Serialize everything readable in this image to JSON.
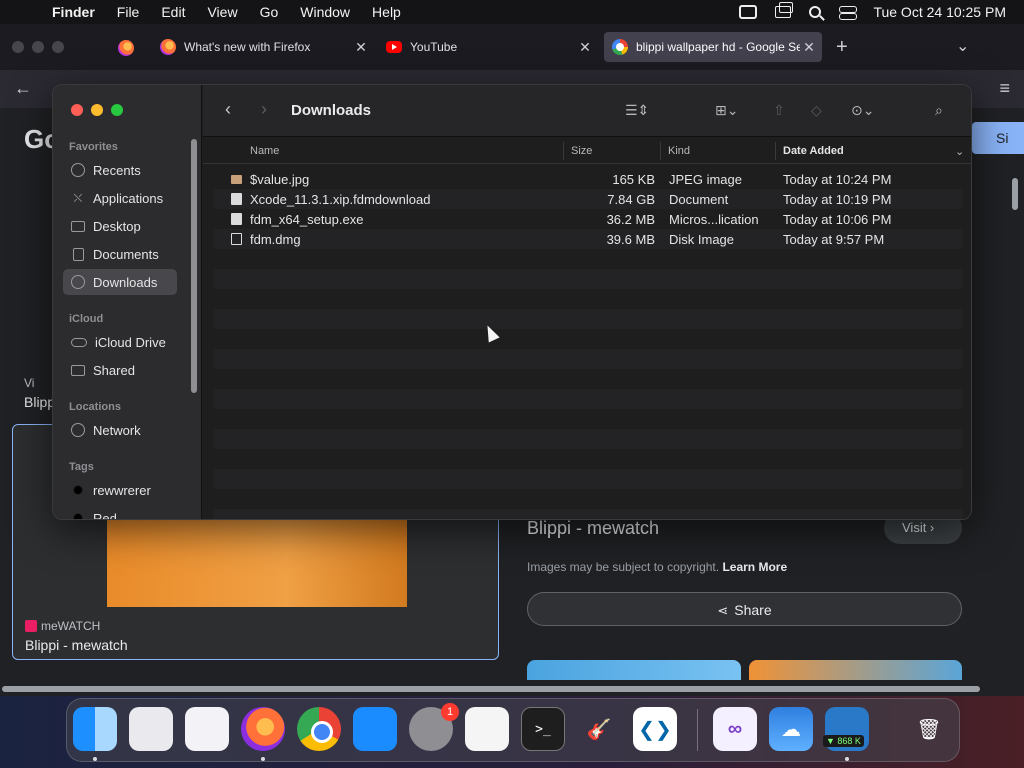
{
  "menubar": {
    "app": "Finder",
    "items": [
      "File",
      "Edit",
      "View",
      "Go",
      "Window",
      "Help"
    ],
    "clock": "Tue Oct 24  10:25 PM"
  },
  "browser": {
    "tabs": [
      {
        "label": "What's new with Firefox",
        "icon": "firefox-icon"
      },
      {
        "label": "YouTube",
        "icon": "youtube-icon"
      },
      {
        "label": "blippi wallpaper hd - Google Se",
        "icon": "google-icon"
      }
    ],
    "new_tab": "+",
    "tab_list": "⌄"
  },
  "page": {
    "logo": "Go",
    "signin": "Si",
    "left_partial_source": "Vi",
    "left_partial_title": "Blipp",
    "card_source": "meWATCH",
    "card_title": "Blippi - mewatch",
    "right_title": "Blippi - mewatch",
    "visit": "Visit  ›",
    "copyright": "Images may be subject to copyright.",
    "learn_more": "Learn More",
    "share": "Share"
  },
  "finder": {
    "title": "Downloads",
    "sidebar": {
      "favorites_label": "Favorites",
      "favorites": [
        {
          "label": "Recents",
          "icon": "clock-icon"
        },
        {
          "label": "Applications",
          "icon": "applications-icon"
        },
        {
          "label": "Desktop",
          "icon": "desktop-icon"
        },
        {
          "label": "Documents",
          "icon": "document-icon"
        },
        {
          "label": "Downloads",
          "icon": "download-icon",
          "selected": true
        }
      ],
      "icloud_label": "iCloud",
      "icloud": [
        {
          "label": "iCloud Drive",
          "icon": "cloud-icon"
        },
        {
          "label": "Shared",
          "icon": "shared-folder-icon"
        }
      ],
      "locations_label": "Locations",
      "locations": [
        {
          "label": "Network",
          "icon": "globe-icon"
        }
      ],
      "tags_label": "Tags",
      "tags": [
        {
          "label": "rewwrerer",
          "color": "#000000"
        },
        {
          "label": "Red",
          "color": "#000000"
        }
      ]
    },
    "columns": {
      "name": "Name",
      "size": "Size",
      "kind": "Kind",
      "date": "Date Added"
    },
    "files": [
      {
        "name": "$value.jpg",
        "size": "165 KB",
        "kind": "JPEG image",
        "date": "Today at 10:24 PM",
        "type": "jpg"
      },
      {
        "name": "Xcode_11.3.1.xip.fdmdownload",
        "size": "7.84 GB",
        "kind": "Document",
        "date": "Today at 10:19 PM",
        "type": "doc"
      },
      {
        "name": "fdm_x64_setup.exe",
        "size": "36.2 MB",
        "kind": "Micros...lication",
        "date": "Today at 10:06 PM",
        "type": "doc"
      },
      {
        "name": "fdm.dmg",
        "size": "39.6 MB",
        "kind": "Disk Image",
        "date": "Today at 9:57 PM",
        "type": "dmg"
      }
    ]
  },
  "dock": {
    "settings_badge": "1",
    "net_speed": "▼ 868 K",
    "terminal_glyph": ">_"
  }
}
